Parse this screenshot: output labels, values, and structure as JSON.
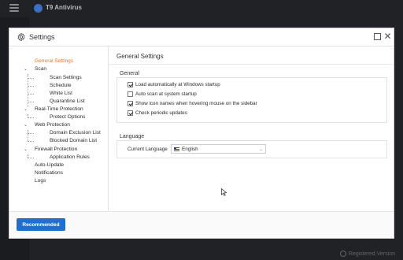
{
  "app": {
    "title": "T9 Antivirus",
    "footer_status": "Registered Version"
  },
  "dialog": {
    "title": "Settings"
  },
  "nav": {
    "items": [
      {
        "label": "General Settings",
        "selected": true
      },
      {
        "label": "Scan"
      },
      {
        "label": "Scan Settings"
      },
      {
        "label": "Schedule"
      },
      {
        "label": "White List"
      },
      {
        "label": "Quarantine List"
      },
      {
        "label": "Real-Time Protection"
      },
      {
        "label": "Protect Options"
      },
      {
        "label": "Web Protection"
      },
      {
        "label": "Domain Exclusion List"
      },
      {
        "label": "Blocked Domain List"
      },
      {
        "label": "Firewall Protection"
      },
      {
        "label": "Application Rules"
      },
      {
        "label": "Auto-Update"
      },
      {
        "label": "Notifications"
      },
      {
        "label": "Logs"
      }
    ]
  },
  "main": {
    "section_title": "General Settings",
    "general": {
      "label": "General",
      "options": [
        {
          "label": "Load automatically at Windows startup",
          "checked": true
        },
        {
          "label": "Auto scan at system startup",
          "checked": false
        },
        {
          "label": "Show icon names when hovering mouse on the sidebar",
          "checked": true
        },
        {
          "label": "Check periodic updates",
          "checked": true
        }
      ]
    },
    "language": {
      "label": "Language",
      "field_label": "Current Language",
      "selected": "English"
    }
  },
  "footer": {
    "recommended_label": "Recommended"
  },
  "colors": {
    "accent": "#1f6fd1",
    "selected_nav": "#e8782a"
  }
}
